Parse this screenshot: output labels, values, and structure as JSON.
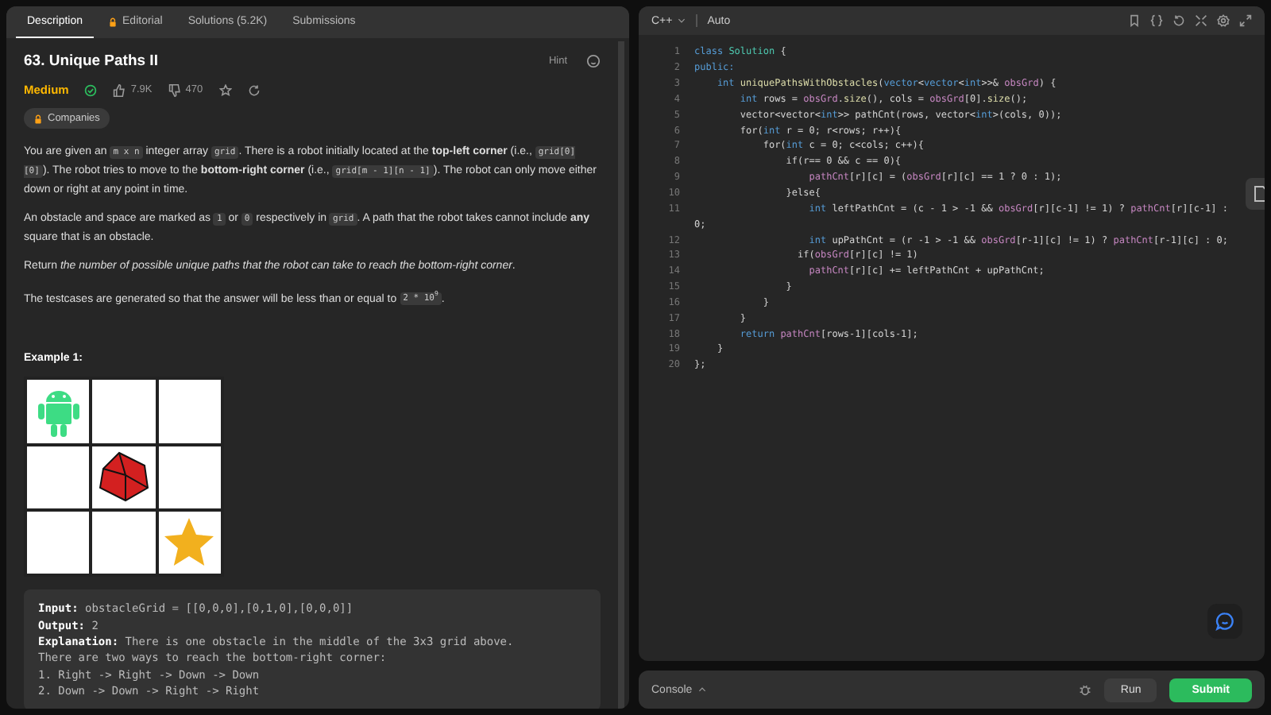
{
  "left_tabs": [
    {
      "label": "Description",
      "selected": true,
      "locked": false
    },
    {
      "label": "Editorial",
      "selected": false,
      "locked": true
    },
    {
      "label": "Solutions (5.2K)",
      "selected": false,
      "locked": false
    },
    {
      "label": "Submissions",
      "selected": false,
      "locked": false
    }
  ],
  "problem": {
    "title": "63. Unique Paths II",
    "hint": "Hint",
    "difficulty": "Medium",
    "solved": true,
    "likes": "7.9K",
    "dislikes": "470",
    "companies": "Companies",
    "paragraphs": [
      [
        {
          "kind": "text",
          "text": "You are given an "
        },
        {
          "kind": "code",
          "text": "m x n"
        },
        {
          "kind": "text",
          "text": " integer array "
        },
        {
          "kind": "code",
          "text": "grid"
        },
        {
          "kind": "text",
          "text": ". There is a robot initially located at the "
        },
        {
          "kind": "bold",
          "text": "top-left corner"
        },
        {
          "kind": "text",
          "text": " (i.e., "
        },
        {
          "kind": "code",
          "text": "grid[0][0]"
        },
        {
          "kind": "text",
          "text": "). The robot tries to move to the "
        },
        {
          "kind": "bold",
          "text": "bottom-right corner"
        },
        {
          "kind": "text",
          "text": " (i.e., "
        },
        {
          "kind": "code",
          "text": "grid[m - 1][n - 1]"
        },
        {
          "kind": "text",
          "text": "). The robot can only move either down or right at any point in time."
        }
      ],
      [
        {
          "kind": "text",
          "text": "An obstacle and space are marked as "
        },
        {
          "kind": "code",
          "text": "1"
        },
        {
          "kind": "text",
          "text": " or "
        },
        {
          "kind": "code",
          "text": "0"
        },
        {
          "kind": "text",
          "text": " respectively in "
        },
        {
          "kind": "code",
          "text": "grid"
        },
        {
          "kind": "text",
          "text": ". A path that the robot takes cannot include "
        },
        {
          "kind": "bold",
          "text": "any"
        },
        {
          "kind": "text",
          "text": " square that is an obstacle."
        }
      ],
      [
        {
          "kind": "text",
          "text": "Return "
        },
        {
          "kind": "italic",
          "text": "the number of possible unique paths that the robot can take to reach the bottom-right corner"
        },
        {
          "kind": "text",
          "text": "."
        }
      ],
      [
        {
          "kind": "text",
          "text": "The testcases are generated so that the answer will be less than or equal to "
        },
        {
          "kind": "code",
          "text": "2 * 10$^{9}$"
        },
        {
          "kind": "text",
          "text": "."
        }
      ]
    ],
    "example_title": "Example 1:",
    "example_lines": [
      "**Input:** obstacleGrid = [[0,0,0],[0,1,0],[0,0,0]]",
      "**Output:** 2",
      "**Explanation:** There is one obstacle in the middle of the 3x3 grid above.",
      "There are two ways to reach the bottom-right corner:",
      "1. Right -> Right -> Down -> Down",
      "2. Down -> Down -> Right -> Right"
    ]
  },
  "editor": {
    "language": "C++",
    "mode": "Auto",
    "lines": [
      {
        "number": "1",
        "tokens": [
          {
            "kind": "kw",
            "text": "class "
          },
          {
            "kind": "type",
            "text": "Solution"
          },
          {
            "kind": "txt",
            "text": " {"
          }
        ]
      },
      {
        "number": "2",
        "tokens": [
          {
            "kind": "kw",
            "text": "public:"
          }
        ]
      },
      {
        "number": "3",
        "tokens": [
          {
            "kind": "kw",
            "text": "    int "
          },
          {
            "kind": "fn",
            "text": "uniquePathsWithObstacles"
          },
          {
            "kind": "txt",
            "text": "("
          },
          {
            "kind": "kw",
            "text": "vector"
          },
          {
            "kind": "txt",
            "text": "<"
          },
          {
            "kind": "kw",
            "text": "vector"
          },
          {
            "kind": "txt",
            "text": "<"
          },
          {
            "kind": "kw",
            "text": "int"
          },
          {
            "kind": "txt",
            "text": ">>& "
          },
          {
            "kind": "var",
            "text": "obsGrd"
          },
          {
            "kind": "txt",
            "text": ") {"
          }
        ]
      },
      {
        "number": "4",
        "tokens": [
          {
            "kind": "kw",
            "text": "        int "
          },
          {
            "kind": "txt",
            "text": "rows = "
          },
          {
            "kind": "var",
            "text": "obsGrd"
          },
          {
            "kind": "txt",
            "text": "."
          },
          {
            "kind": "fn",
            "text": "size"
          },
          {
            "kind": "txt",
            "text": "(), cols = "
          },
          {
            "kind": "var",
            "text": "obsGrd"
          },
          {
            "kind": "txt",
            "text": "[0]."
          },
          {
            "kind": "fn",
            "text": "size"
          },
          {
            "kind": "txt",
            "text": "();"
          }
        ]
      },
      {
        "number": "5",
        "tokens": [
          {
            "kind": "txt",
            "text": "        vector<vector<"
          },
          {
            "kind": "kw",
            "text": "int"
          },
          {
            "kind": "txt",
            "text": ">> pathCnt(rows, vector<"
          },
          {
            "kind": "kw",
            "text": "int"
          },
          {
            "kind": "txt",
            "text": ">(cols, 0));"
          }
        ]
      },
      {
        "number": "6",
        "tokens": [
          {
            "kind": "txt",
            "text": "        for("
          },
          {
            "kind": "kw",
            "text": "int "
          },
          {
            "kind": "txt",
            "text": "r = 0; r<rows; r++){"
          }
        ]
      },
      {
        "number": "7",
        "tokens": [
          {
            "kind": "txt",
            "text": "            for("
          },
          {
            "kind": "kw",
            "text": "int "
          },
          {
            "kind": "txt",
            "text": "c = 0; c<cols; c++){"
          }
        ]
      },
      {
        "number": "8",
        "tokens": [
          {
            "kind": "txt",
            "text": "                if(r== 0 && c == 0){"
          }
        ]
      },
      {
        "number": "9",
        "tokens": [
          {
            "kind": "var",
            "text": "                    pathCnt"
          },
          {
            "kind": "txt",
            "text": "[r][c] = ("
          },
          {
            "kind": "var",
            "text": "obsGrd"
          },
          {
            "kind": "txt",
            "text": "[r][c] == 1 ? 0 : 1);"
          }
        ]
      },
      {
        "number": "10",
        "tokens": [
          {
            "kind": "txt",
            "text": "                }else{"
          }
        ]
      },
      {
        "number": "11",
        "tokens": [
          {
            "kind": "kw",
            "text": "                    int "
          },
          {
            "kind": "txt",
            "text": "leftPathCnt = (c - 1 > -1 && "
          },
          {
            "kind": "var",
            "text": "obsGrd"
          },
          {
            "kind": "txt",
            "text": "[r][c-1] != 1) ? "
          },
          {
            "kind": "var",
            "text": "pathCnt"
          },
          {
            "kind": "txt",
            "text": "[r][c-1] :"
          }
        ],
        "continuation": "0;"
      },
      {
        "number": "12",
        "tokens": [
          {
            "kind": "kw",
            "text": "                    int "
          },
          {
            "kind": "txt",
            "text": "upPathCnt = (r -1 > -1 && "
          },
          {
            "kind": "var",
            "text": "obsGrd"
          },
          {
            "kind": "txt",
            "text": "[r-1][c] != 1) ? "
          },
          {
            "kind": "var",
            "text": "pathCnt"
          },
          {
            "kind": "txt",
            "text": "[r-1][c] : 0;"
          }
        ]
      },
      {
        "number": "13",
        "tokens": [
          {
            "kind": "txt",
            "text": "                  if("
          },
          {
            "kind": "var",
            "text": "obsGrd"
          },
          {
            "kind": "txt",
            "text": "[r][c] != 1)"
          }
        ]
      },
      {
        "number": "14",
        "tokens": [
          {
            "kind": "var",
            "text": "                    pathCnt"
          },
          {
            "kind": "txt",
            "text": "[r][c] += leftPathCnt + upPathCnt;"
          }
        ]
      },
      {
        "number": "15",
        "tokens": [
          {
            "kind": "txt",
            "text": "                }"
          }
        ]
      },
      {
        "number": "16",
        "tokens": [
          {
            "kind": "txt",
            "text": "            }"
          }
        ]
      },
      {
        "number": "17",
        "tokens": [
          {
            "kind": "txt",
            "text": "        }"
          }
        ]
      },
      {
        "number": "18",
        "tokens": [
          {
            "kind": "kw",
            "text": "        return "
          },
          {
            "kind": "var",
            "text": "pathCnt"
          },
          {
            "kind": "txt",
            "text": "[rows-1][cols-1];"
          }
        ]
      },
      {
        "number": "19",
        "tokens": [
          {
            "kind": "txt",
            "text": "    }"
          }
        ]
      },
      {
        "number": "20",
        "tokens": [
          {
            "kind": "txt",
            "text": "};"
          }
        ]
      }
    ]
  },
  "console": {
    "label": "Console",
    "run": "Run",
    "submit": "Submit"
  }
}
